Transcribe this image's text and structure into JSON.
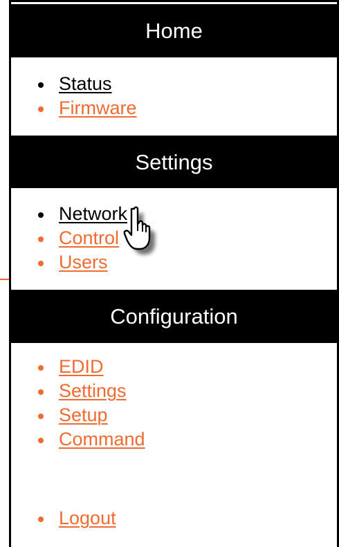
{
  "sections": {
    "home": {
      "title": "Home",
      "items": [
        {
          "label": "Status",
          "state": "visited"
        },
        {
          "label": "Firmware",
          "state": "link"
        }
      ]
    },
    "settings": {
      "title": "Settings",
      "items": [
        {
          "label": "Network",
          "state": "visited"
        },
        {
          "label": "Control",
          "state": "link"
        },
        {
          "label": "Users",
          "state": "link"
        }
      ]
    },
    "configuration": {
      "title": "Configuration",
      "items": [
        {
          "label": "EDID",
          "state": "link"
        },
        {
          "label": "Settings",
          "state": "link"
        },
        {
          "label": "Setup",
          "state": "link"
        },
        {
          "label": "Command",
          "state": "link"
        }
      ]
    }
  },
  "logout": {
    "label": "Logout"
  },
  "colors": {
    "header_bg": "#000000",
    "header_text": "#ffffff",
    "link": "#f26a30",
    "visited": "#000000"
  },
  "cursor": {
    "icon": "hand-pointer-icon",
    "hovering": "Network"
  }
}
